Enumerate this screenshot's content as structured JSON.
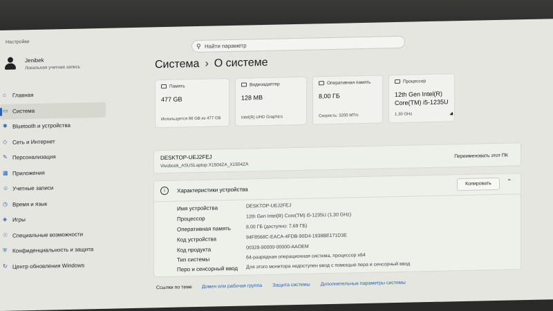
{
  "window": {
    "title": "Настройки"
  },
  "search": {
    "placeholder": "Найти параметр"
  },
  "user": {
    "name": "Jenibek",
    "account_type": "Локальная учетная запись"
  },
  "sidebar": {
    "items": [
      {
        "label": "Главная",
        "icon": "home-icon"
      },
      {
        "label": "Система",
        "icon": "monitor-icon",
        "active": true
      },
      {
        "label": "Bluetooth и устройства",
        "icon": "bluetooth-icon"
      },
      {
        "label": "Сеть и Интернет",
        "icon": "wifi-icon"
      },
      {
        "label": "Персонализация",
        "icon": "brush-icon"
      },
      {
        "label": "Приложения",
        "icon": "apps-icon"
      },
      {
        "label": "Учетные записи",
        "icon": "person-icon"
      },
      {
        "label": "Время и язык",
        "icon": "globe-clock-icon"
      },
      {
        "label": "Игры",
        "icon": "gamepad-icon"
      },
      {
        "label": "Специальные возможности",
        "icon": "accessibility-icon"
      },
      {
        "label": "Конфиденциальность и защита",
        "icon": "shield-icon"
      },
      {
        "label": "Центр обновления Windows",
        "icon": "update-icon"
      }
    ]
  },
  "breadcrumb": {
    "parent": "Система",
    "separator": "›",
    "current": "О системе"
  },
  "cards": {
    "storage": {
      "label": "Память",
      "value": "477 GB",
      "sub": "Используется 66 GB из 477 GB"
    },
    "gpu": {
      "label": "Видеоадаптер",
      "value": "128 MB",
      "sub": "Intel(R) UHD Graphics"
    },
    "ram": {
      "label": "Оперативная память",
      "value": "8,00 ГБ",
      "sub": "Скорость: 3200 МТ/с"
    },
    "cpu": {
      "label": "Процессор",
      "value_line1": "12th Gen Intel(R)",
      "value_line2": "Core(TM) i5-1235U",
      "sub": "1,30 GHz"
    }
  },
  "device": {
    "name": "DESKTOP-UEJ2FEJ",
    "model": "Vivobook_ASUSLaptop X1504ZA_X1504ZA",
    "rename_label": "Переименовать этот ПК"
  },
  "specs": {
    "title": "Характеристики устройства",
    "copy_label": "Копировать",
    "rows": [
      {
        "key": "Имя устройства",
        "value": "DESKTOP-UEJ2FEJ"
      },
      {
        "key": "Процессор",
        "value": "12th Gen Intel(R) Core(TM) i5-1235U (1,30 GHz)"
      },
      {
        "key": "Оперативная память",
        "value": "8,00 ГБ (доступно: 7,69 ГБ)"
      },
      {
        "key": "Код устройства",
        "value": "94F8568C-EACA-4FDB-90D4-1938BE171D3E"
      },
      {
        "key": "Код продукта",
        "value": "00328-90000-00000-AAOEM"
      },
      {
        "key": "Тип системы",
        "value": "64-разрядная операционная система, процессор x64"
      },
      {
        "key": "Перо и сенсорный ввод",
        "value": "Для этого монитора недоступен ввод с помощью пера и сенсорный ввод"
      }
    ]
  },
  "related_links": {
    "label": "Ссылки по теме",
    "links": [
      "Домен или рабочая группа",
      "Защита системы",
      "Дополнительные параметры системы"
    ]
  }
}
